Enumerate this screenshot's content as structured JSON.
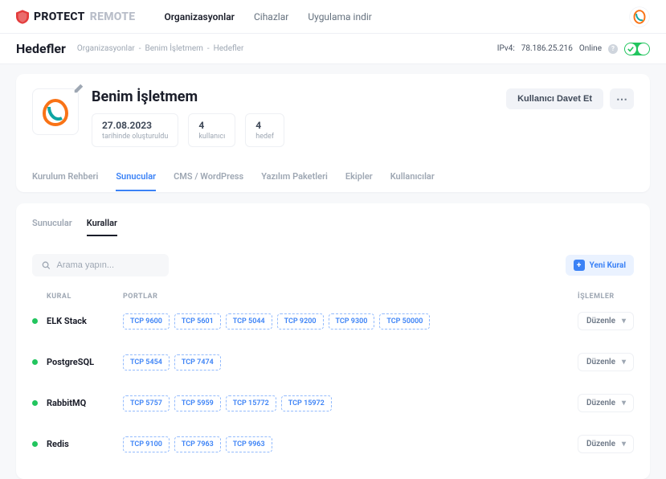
{
  "header": {
    "brand_a": "PROTECT",
    "brand_b": "REMOTE",
    "nav": [
      "Organizasyonlar",
      "Cihazlar",
      "Uygulama indir"
    ]
  },
  "subheader": {
    "title": "Hedefler",
    "crumbs": [
      "Organizasyonlar",
      "Benim İşletmem",
      "Hedefler"
    ],
    "ipv4_label": "IPv4:",
    "ipv4": "78.186.25.216",
    "online": "Online"
  },
  "org": {
    "name": "Benim İşletmem",
    "stats": [
      {
        "big": "27.08.2023",
        "small": "tarihinde oluşturuldu"
      },
      {
        "big": "4",
        "small": "kullanıcı"
      },
      {
        "big": "4",
        "small": "hedef"
      }
    ],
    "invite": "Kullanıcı Davet Et"
  },
  "tabs": [
    "Kurulum Rehberi",
    "Sunucular",
    "CMS / WordPress",
    "Yazılım Paketleri",
    "Ekipler",
    "Kullanıcılar"
  ],
  "tabs_active": 1,
  "subtabs": [
    "Sunucular",
    "Kurallar"
  ],
  "subtabs_active": 1,
  "search": {
    "placeholder": "Arama yapın..."
  },
  "new_rule": "Yeni Kural",
  "columns": {
    "name": "KURAL",
    "ports": "PORTLAR",
    "actions": "İŞLEMLER"
  },
  "action_label": "Düzenle",
  "rules": [
    {
      "name": "ELK Stack",
      "ports": [
        "TCP 9600",
        "TCP 5601",
        "TCP 5044",
        "TCP 9200",
        "TCP 9300",
        "TCP 50000"
      ]
    },
    {
      "name": "PostgreSQL",
      "ports": [
        "TCP 5454",
        "TCP 7474"
      ]
    },
    {
      "name": "RabbitMQ",
      "ports": [
        "TCP 5757",
        "TCP 5959",
        "TCP 15772",
        "TCP 15972"
      ]
    },
    {
      "name": "Redis",
      "ports": [
        "TCP 9100",
        "TCP 7963",
        "TCP 9963"
      ]
    }
  ]
}
